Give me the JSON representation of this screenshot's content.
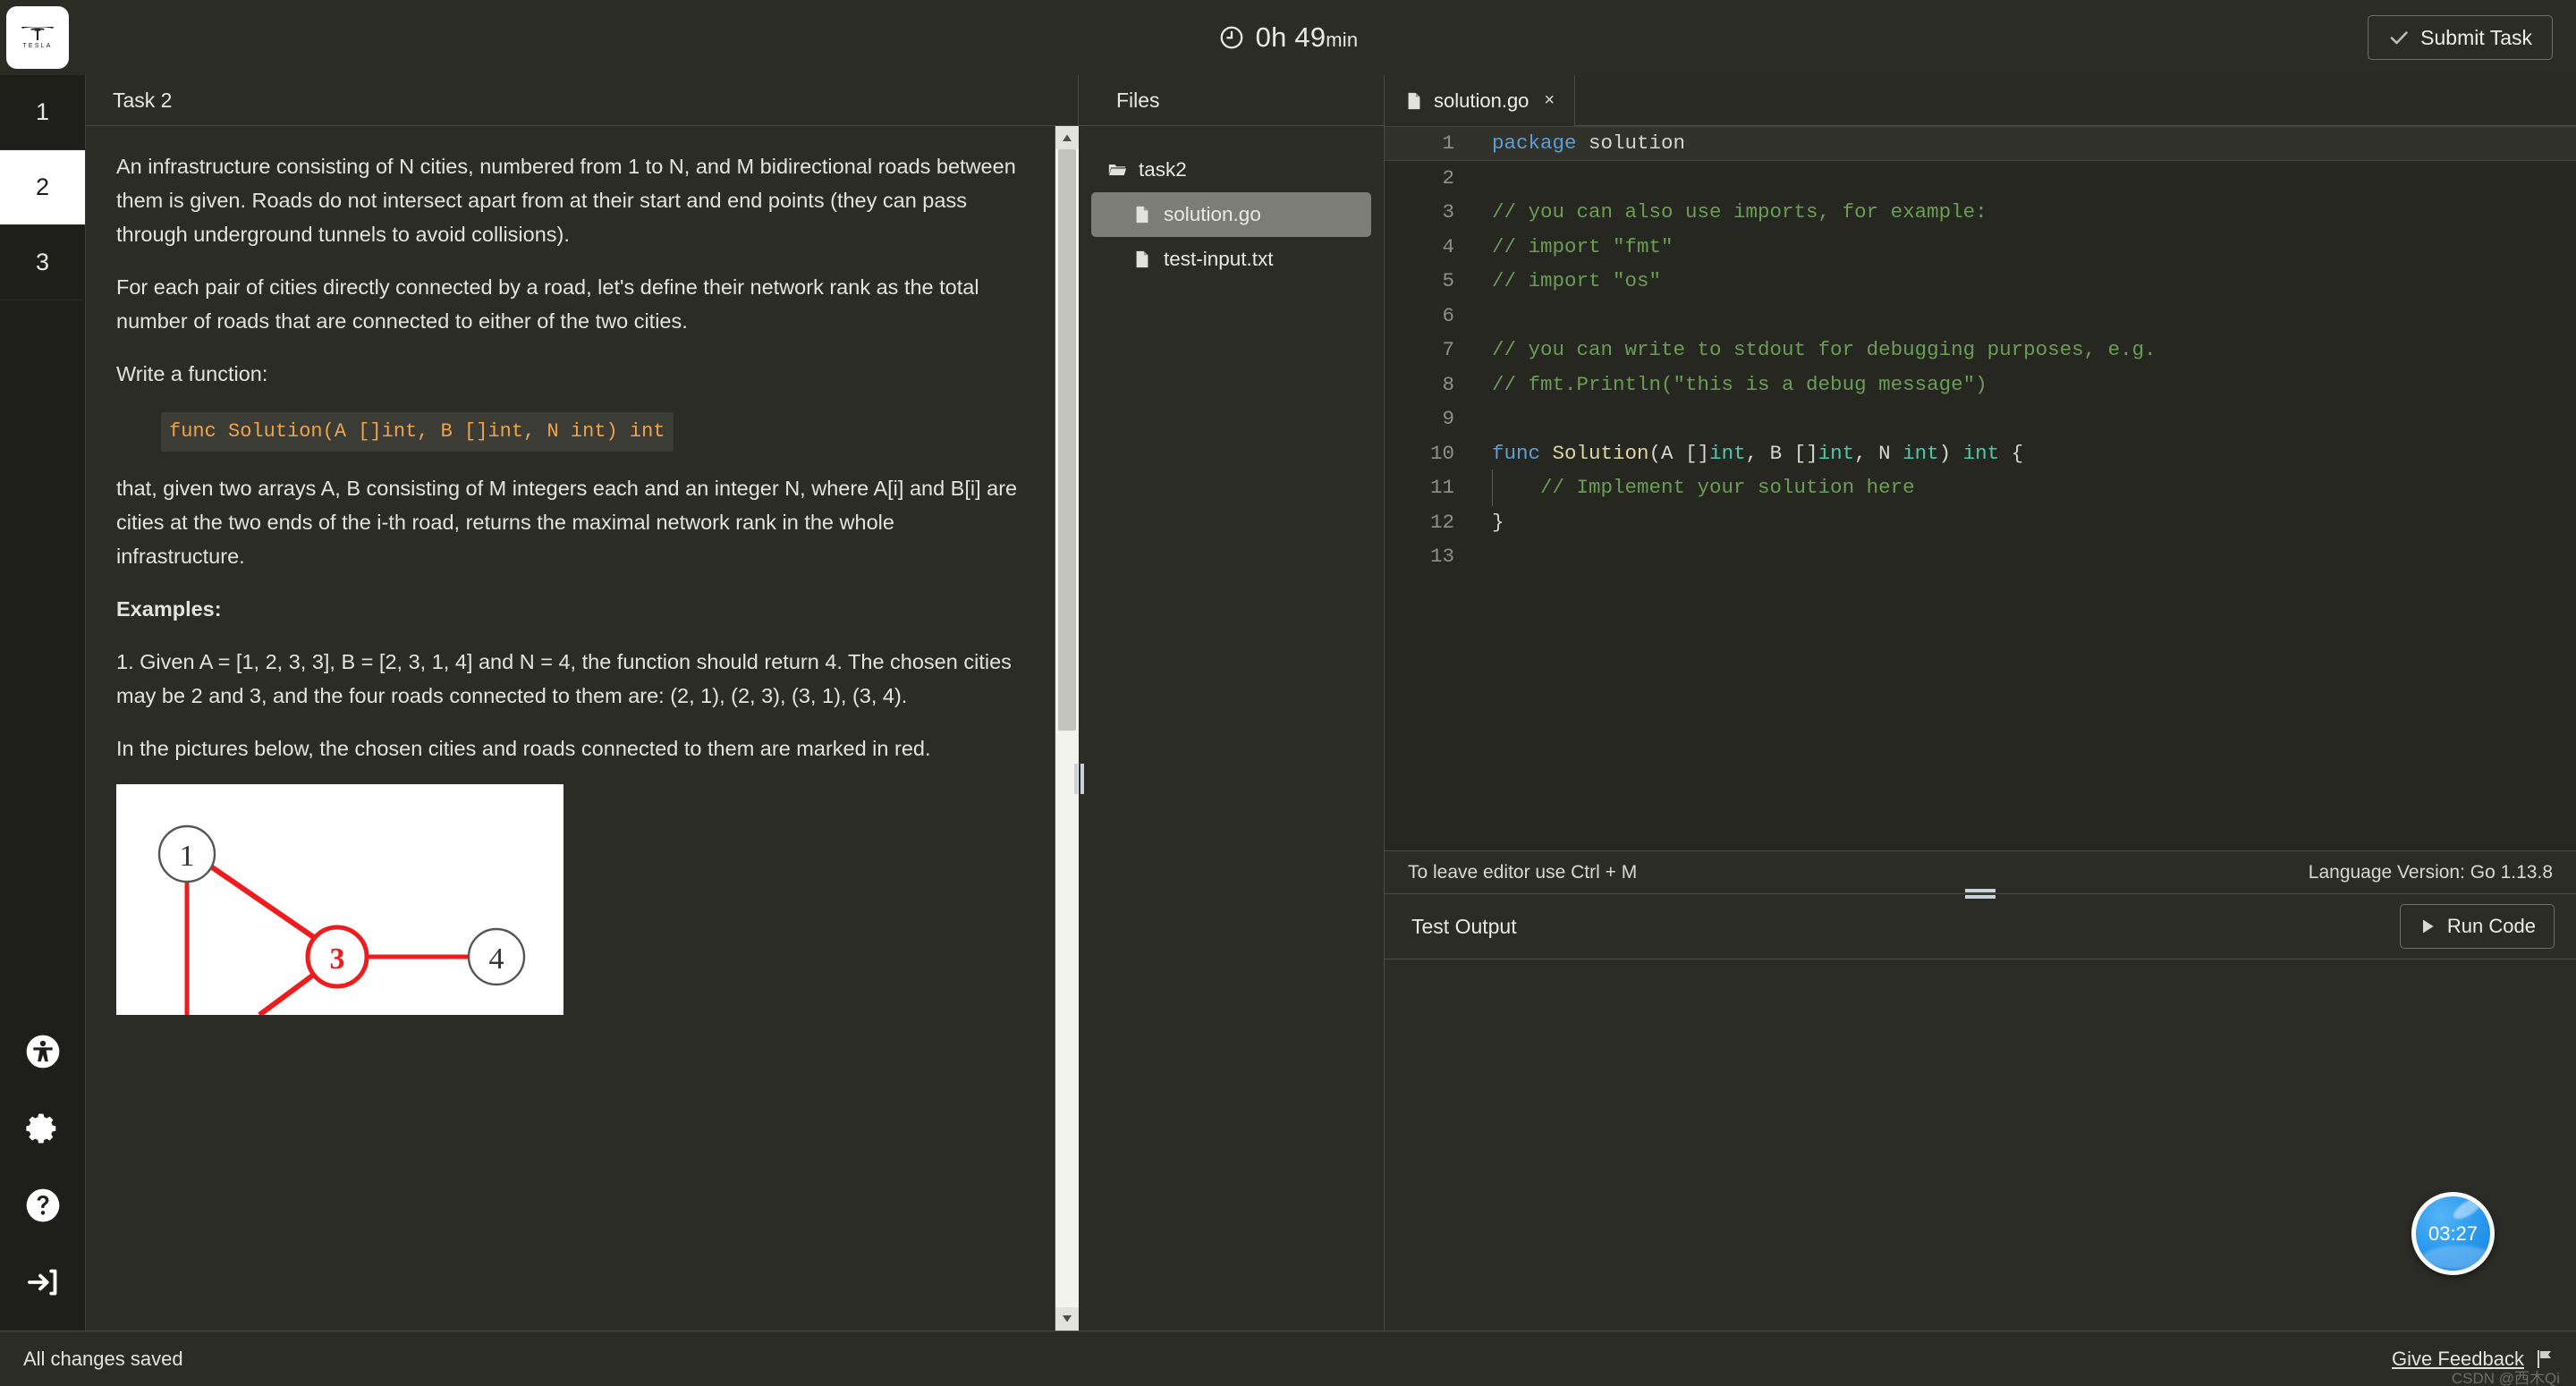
{
  "topbar": {
    "logo_name": "tesla-logo",
    "logo_word": "TESLA",
    "timer_hours": "0h ",
    "timer_minutes": "49",
    "timer_unit": "min",
    "submit_label": "Submit Task"
  },
  "rail": {
    "tasks": [
      {
        "label": "1",
        "active": false
      },
      {
        "label": "2",
        "active": true
      },
      {
        "label": "3",
        "active": false
      }
    ],
    "icons": [
      "accessibility-icon",
      "gear-icon",
      "help-icon",
      "logout-icon"
    ]
  },
  "description": {
    "title": "Task 2",
    "paragraphs": [
      "An infrastructure consisting of N cities, numbered from 1 to N, and M bidirectional roads between them is given. Roads do not intersect apart from at their start and end points (they can pass through underground tunnels to avoid collisions).",
      "For each pair of cities directly connected by a road, let's define their network rank as the total number of roads that are connected to either of the two cities.",
      "Write a function:"
    ],
    "code_signature": "func Solution(A []int, B []int, N int) int",
    "paragraphs_after": [
      "that, given two arrays A, B consisting of M integers each and an integer N, where A[i] and B[i] are cities at the two ends of the i-th road, returns the maximal network rank in the whole infrastructure."
    ],
    "examples_heading": "Examples:",
    "example_1": "1. Given A = [1, 2, 3, 3], B = [2, 3, 1, 4] and N = 4, the function should return 4. The chosen cities may be 2 and 3, and the four roads connected to them are: (2, 1), (2, 3), (3, 1), (3, 4).",
    "figure_note": "In the pictures below, the chosen cities and roads connected to them are marked in red.",
    "figure": {
      "nodes": [
        {
          "label": "1",
          "highlighted": false
        },
        {
          "label": "3",
          "highlighted": true
        },
        {
          "label": "4",
          "highlighted": false
        }
      ],
      "edge_color": "#ee1c1c",
      "node_color": "#555555"
    }
  },
  "files": {
    "title": "Files",
    "tree": [
      {
        "name": "task2",
        "type": "folder",
        "selected": false
      },
      {
        "name": "solution.go",
        "type": "file",
        "selected": true
      },
      {
        "name": "test-input.txt",
        "type": "file",
        "selected": false
      }
    ]
  },
  "editor": {
    "tab_name": "solution.go",
    "tab_close": "×",
    "lines": [
      {
        "n": "1",
        "active": true,
        "indent": false,
        "tokens": [
          {
            "t": "package",
            "c": "tok-kw"
          },
          {
            "t": " solution",
            "c": "tok-plain"
          }
        ]
      },
      {
        "n": "2",
        "active": false,
        "indent": false,
        "tokens": []
      },
      {
        "n": "3",
        "active": false,
        "indent": false,
        "tokens": [
          {
            "t": "// you can also use imports, for example:",
            "c": "tok-cmt"
          }
        ]
      },
      {
        "n": "4",
        "active": false,
        "indent": false,
        "tokens": [
          {
            "t": "// import \"fmt\"",
            "c": "tok-cmt"
          }
        ]
      },
      {
        "n": "5",
        "active": false,
        "indent": false,
        "tokens": [
          {
            "t": "// import \"os\"",
            "c": "tok-cmt"
          }
        ]
      },
      {
        "n": "6",
        "active": false,
        "indent": false,
        "tokens": []
      },
      {
        "n": "7",
        "active": false,
        "indent": false,
        "tokens": [
          {
            "t": "// you can write to stdout for debugging purposes, e.g.",
            "c": "tok-cmt"
          }
        ]
      },
      {
        "n": "8",
        "active": false,
        "indent": false,
        "tokens": [
          {
            "t": "// fmt.Println(\"this is a debug message\")",
            "c": "tok-cmt"
          }
        ]
      },
      {
        "n": "9",
        "active": false,
        "indent": false,
        "tokens": []
      },
      {
        "n": "10",
        "active": false,
        "indent": false,
        "tokens": [
          {
            "t": "func ",
            "c": "tok-kw"
          },
          {
            "t": "Solution",
            "c": "tok-fn"
          },
          {
            "t": "(A []",
            "c": "tok-plain"
          },
          {
            "t": "int",
            "c": "tok-type"
          },
          {
            "t": ", B []",
            "c": "tok-plain"
          },
          {
            "t": "int",
            "c": "tok-type"
          },
          {
            "t": ", N ",
            "c": "tok-plain"
          },
          {
            "t": "int",
            "c": "tok-type"
          },
          {
            "t": ") ",
            "c": "tok-plain"
          },
          {
            "t": "int",
            "c": "tok-type"
          },
          {
            "t": " {",
            "c": "tok-plain"
          }
        ]
      },
      {
        "n": "11",
        "active": false,
        "indent": true,
        "tokens": [
          {
            "t": "    // Implement your solution here",
            "c": "tok-cmt"
          }
        ]
      },
      {
        "n": "12",
        "active": false,
        "indent": false,
        "tokens": [
          {
            "t": "}",
            "c": "tok-plain"
          }
        ]
      },
      {
        "n": "13",
        "active": false,
        "indent": false,
        "tokens": []
      }
    ],
    "status_left": "To leave editor use Ctrl + M",
    "status_right": "Language Version: Go 1.13.8"
  },
  "test_output": {
    "title": "Test Output",
    "run_label": "Run Code"
  },
  "bubble": {
    "time": "03:27"
  },
  "bottombar": {
    "saved": "All changes saved",
    "feedback": "Give Feedback",
    "watermark": "CSDN @西木Qi"
  },
  "colors": {
    "app_bg": "#2b2c26",
    "rail_bg": "#1e1f1b",
    "accent_blue": "#2b9bf0",
    "code_orange": "#f0a44a",
    "edge_red": "#ee1c1c"
  }
}
